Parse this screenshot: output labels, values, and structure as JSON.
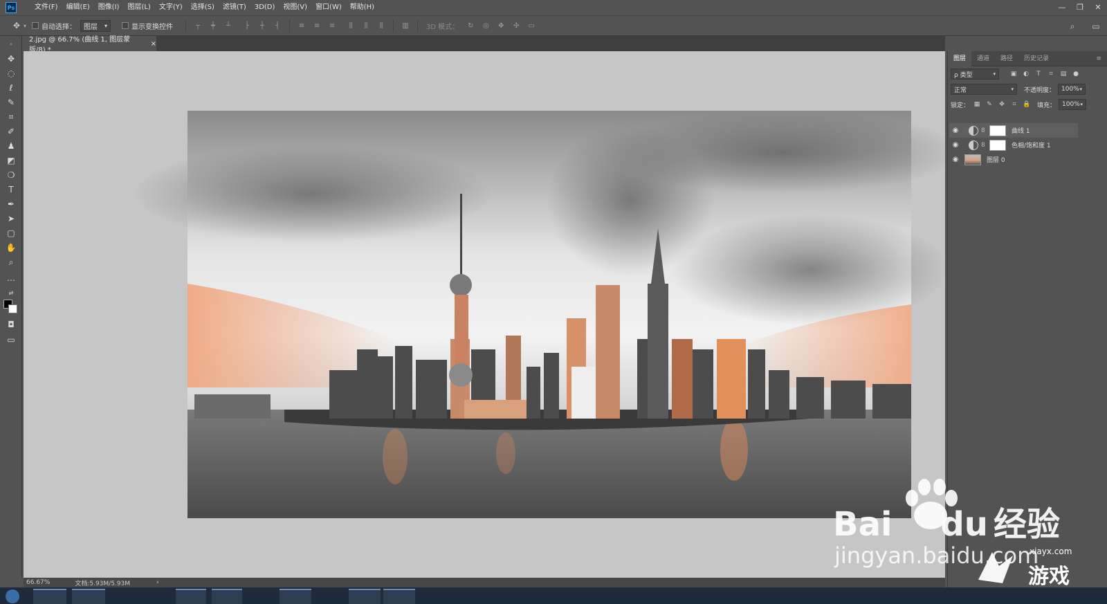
{
  "app": {
    "logo": "Ps"
  },
  "menu": [
    "文件(F)",
    "编辑(E)",
    "图像(I)",
    "图层(L)",
    "文字(Y)",
    "选择(S)",
    "滤镜(T)",
    "3D(D)",
    "视图(V)",
    "窗口(W)",
    "帮助(H)"
  ],
  "window_controls": {
    "minimize": "—",
    "restore": "❐",
    "close": "✕"
  },
  "options": {
    "auto_select_label": "自动选择：",
    "auto_select_value": "图层",
    "show_transform_label": "显示变换控件",
    "mode_3d_label": "3D 模式："
  },
  "document": {
    "tab_title": "2.jpg @ 66.7% (曲线 1, 图层蒙版/8) *",
    "tab_close": "×"
  },
  "status": {
    "zoom": "66.67%",
    "doc_size": "文档:5.93M/5.93M",
    "arrow": "›"
  },
  "panel": {
    "tabs": [
      "图层",
      "通道",
      "路径",
      "历史记录"
    ],
    "menu_icon": "≡",
    "filter_label": "ρ 类型",
    "blend_mode": "正常",
    "opacity_label": "不透明度：",
    "opacity_value": "100%",
    "lock_label": "锁定：",
    "fill_label": "填充：",
    "fill_value": "100%",
    "layers": [
      {
        "name": "曲线 1",
        "type": "adjustment",
        "selected": true
      },
      {
        "name": "色相/饱和度 1",
        "type": "adjustment",
        "selected": false
      },
      {
        "name": "图层 0",
        "type": "image",
        "selected": false
      }
    ]
  },
  "watermark": {
    "baidu_text": "Bai",
    "baidu_du": "du",
    "jingyan": "经验",
    "url": "jingyan.baidu.com",
    "site": "xiayx.com",
    "site_name": "游戏"
  },
  "colors": {
    "accent_blue": "#31a8ff",
    "sky_orange": "#f0a882",
    "building_orange": "#e08a5a"
  }
}
